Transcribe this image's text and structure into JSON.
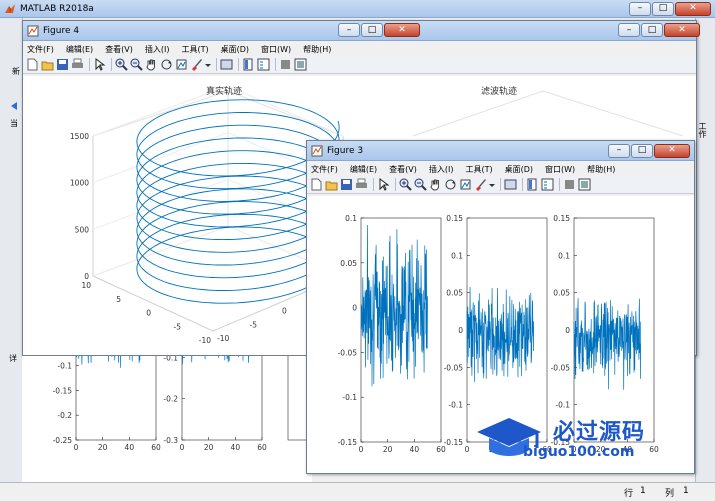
{
  "main_window": {
    "title": "MATLAB R2018a"
  },
  "figure4": {
    "title": "Figure 4",
    "plot_left_title": "真实轨迹",
    "plot_right_title": "滤波轨迹",
    "menu": [
      "文件(F)",
      "编辑(E)",
      "查看(V)",
      "插入(I)",
      "工具(T)",
      "桌面(D)",
      "窗口(W)",
      "帮助(H)"
    ]
  },
  "figure3": {
    "title": "Figure 3",
    "menu": [
      "文件(F)",
      "编辑(E)",
      "查看(V)",
      "插入(I)",
      "工具(T)",
      "桌面(D)",
      "窗口(W)",
      "帮助(H)"
    ]
  },
  "status": {
    "row_label": "行",
    "row_value": "1",
    "col_label": "列",
    "col_value": "1"
  },
  "watermark": {
    "text": "必过源码",
    "url": "biguo100.com"
  },
  "partial_labels": {
    "left_top": "新",
    "left_mid": "当",
    "left_bottom": "详",
    "right_side": "工作"
  },
  "colors": {
    "series": "#0072bd",
    "titlebar": "#b9d1ef",
    "close": "#c7432b"
  },
  "chart_data": [
    {
      "type": "line3d",
      "title": "真实轨迹",
      "zlim": [
        0,
        1500
      ],
      "zticks": [
        "0",
        "500",
        "1000",
        "1500"
      ],
      "xticks": [
        "-10",
        "-5",
        "0",
        "5",
        "10"
      ],
      "yticks": [
        "-10",
        "-5",
        "0",
        "5",
        "10"
      ],
      "grid": true
    },
    {
      "type": "line",
      "ylim": [
        -0.15,
        0.1
      ],
      "yticks": [
        "0.1",
        "0.05",
        "0",
        "-0.05",
        "-0.1",
        "-0.15"
      ],
      "xlim": [
        0,
        60
      ],
      "xticks": [
        "0",
        "20",
        "40",
        "60"
      ],
      "grid": false
    },
    {
      "type": "line",
      "ylim": [
        -0.15,
        0.15
      ],
      "yticks": [
        "0.15",
        "0.1",
        "0.05",
        "0",
        "-0.05",
        "-0.1",
        "-0.15"
      ],
      "xlim": [
        0,
        60
      ],
      "xticks": [
        "0",
        "20",
        "40",
        "60"
      ],
      "grid": false
    },
    {
      "type": "line",
      "ylim": [
        -0.15,
        0.15
      ],
      "yticks": [
        "0.15",
        "0.1",
        "0.05",
        "0",
        "-0.05",
        "-0.1",
        "-0.15"
      ],
      "xlim": [
        0,
        60
      ],
      "xticks": [
        "0",
        "20",
        "40",
        "60"
      ],
      "grid": false
    },
    {
      "type": "line",
      "ylim": [
        -0.25,
        0
      ],
      "yticks": [
        "-0.1",
        "-0.15",
        "-0.2",
        "-0.25"
      ],
      "xlim": [
        0,
        60
      ],
      "xticks": [
        "0",
        "20",
        "40",
        "60"
      ],
      "grid": false
    },
    {
      "type": "line",
      "ylim": [
        -0.3,
        0
      ],
      "yticks": [
        "-0.1",
        "-0.2",
        "-0.3"
      ],
      "xlim": [
        0,
        60
      ],
      "xticks": [
        "0",
        "20",
        "40",
        "60"
      ],
      "grid": false
    }
  ]
}
